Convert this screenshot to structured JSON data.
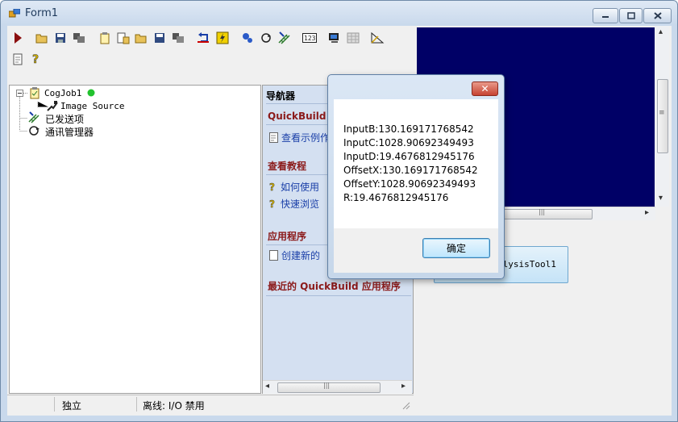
{
  "window": {
    "title": "Form1"
  },
  "tree": {
    "job": "CogJob1",
    "image_source": "Image Source",
    "sent_items": "已发送项",
    "comm_manager": "通讯管理器"
  },
  "navigator": {
    "title": "导航器",
    "sections": [
      {
        "header": "QuickBuild 示",
        "links": [
          "查看示例作"
        ]
      },
      {
        "header": "查看教程",
        "links": [
          "如何使用",
          "快速浏览"
        ]
      },
      {
        "header": "应用程序",
        "links": [
          "创建新的"
        ]
      },
      {
        "header": "最近的 QuickBuild 应用程序",
        "links": []
      }
    ]
  },
  "tool_label": "alysisTool1",
  "status": {
    "cell1": "独立",
    "cell2": "离线: I/O 禁用"
  },
  "dialog": {
    "lines": [
      "InputB:130.169171768542",
      "InputC:1028.90692349493",
      "InputD:19.4676812945176",
      "OffsetX:130.169171768542",
      "OffsetY:1028.90692349493",
      "R:19.4676812945176"
    ],
    "ok_label": "确定",
    "close_label": "✕"
  },
  "scroll_arrows": {
    "left": "◂",
    "right": "▸",
    "up": "▴",
    "down": "▾",
    "grip": "|||",
    "vgrip": "≡"
  },
  "colors": {
    "display_bg": "#000066",
    "nav_header": "#8b1a1a",
    "nav_link": "#1a3fa8",
    "status_green": "#22c22e"
  }
}
